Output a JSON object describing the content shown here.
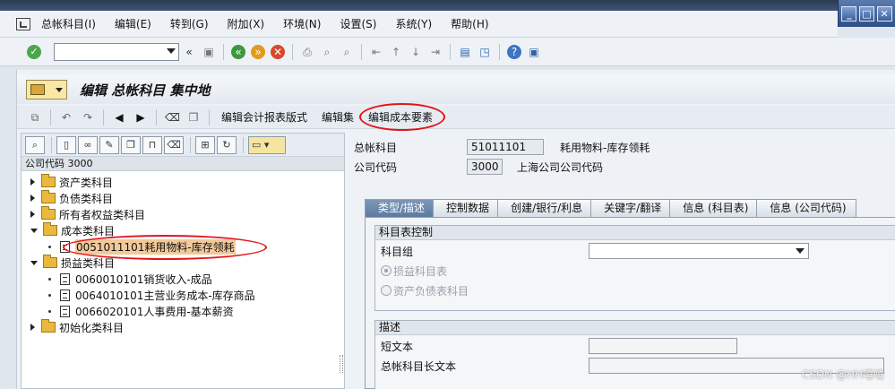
{
  "window": {
    "buttons": [
      "_",
      "□",
      "✕"
    ]
  },
  "menubar": {
    "items": [
      "总帐科目(I)",
      "编辑(E)",
      "转到(G)",
      "附加(X)",
      "环境(N)",
      "设置(S)",
      "系统(Y)",
      "帮助(H)"
    ]
  },
  "std_toolbar": {
    "command_field_value": ""
  },
  "title": "编辑 总帐科目 集中地",
  "app_toolbar": {
    "buttons": [
      "编辑会计报表版式",
      "编辑集",
      "编辑成本要素"
    ]
  },
  "tree": {
    "header": "公司代码 3000",
    "nodes": [
      {
        "label": "资产类科目"
      },
      {
        "label": "负债类科目"
      },
      {
        "label": "所有者权益类科目"
      },
      {
        "label": "成本类科目"
      },
      {
        "label": "0051011101耗用物料-库存领耗"
      },
      {
        "label": "损益类科目"
      },
      {
        "label": "0060010101销货收入-成品"
      },
      {
        "label": "0064010101主营业务成本-库存商品"
      },
      {
        "label": "0066020101人事费用-基本薪资"
      },
      {
        "label": "初始化类科目"
      }
    ]
  },
  "detail": {
    "gl_account_label": "总帐科目",
    "gl_account_value": "51011101",
    "gl_account_desc": "耗用物料-库存领耗",
    "company_code_label": "公司代码",
    "company_code_value": "3000",
    "company_code_desc": "上海公司公司代码"
  },
  "tabs": [
    "类型/描述",
    "控制数据",
    "创建/银行/利息",
    "关键字/翻译",
    "信息 (科目表)",
    "信息 (公司代码)"
  ],
  "chart_control": {
    "title": "科目表控制",
    "account_group_label": "科目组",
    "account_group_value": "",
    "radio_pl": "损益科目表",
    "radio_bs": "资产负债表科目"
  },
  "description": {
    "title": "描述",
    "short_text_label": "短文本",
    "short_text_value": "",
    "long_text_label": "总帐科目长文本"
  },
  "watermark": "CSDN @HH嘻嘻"
}
